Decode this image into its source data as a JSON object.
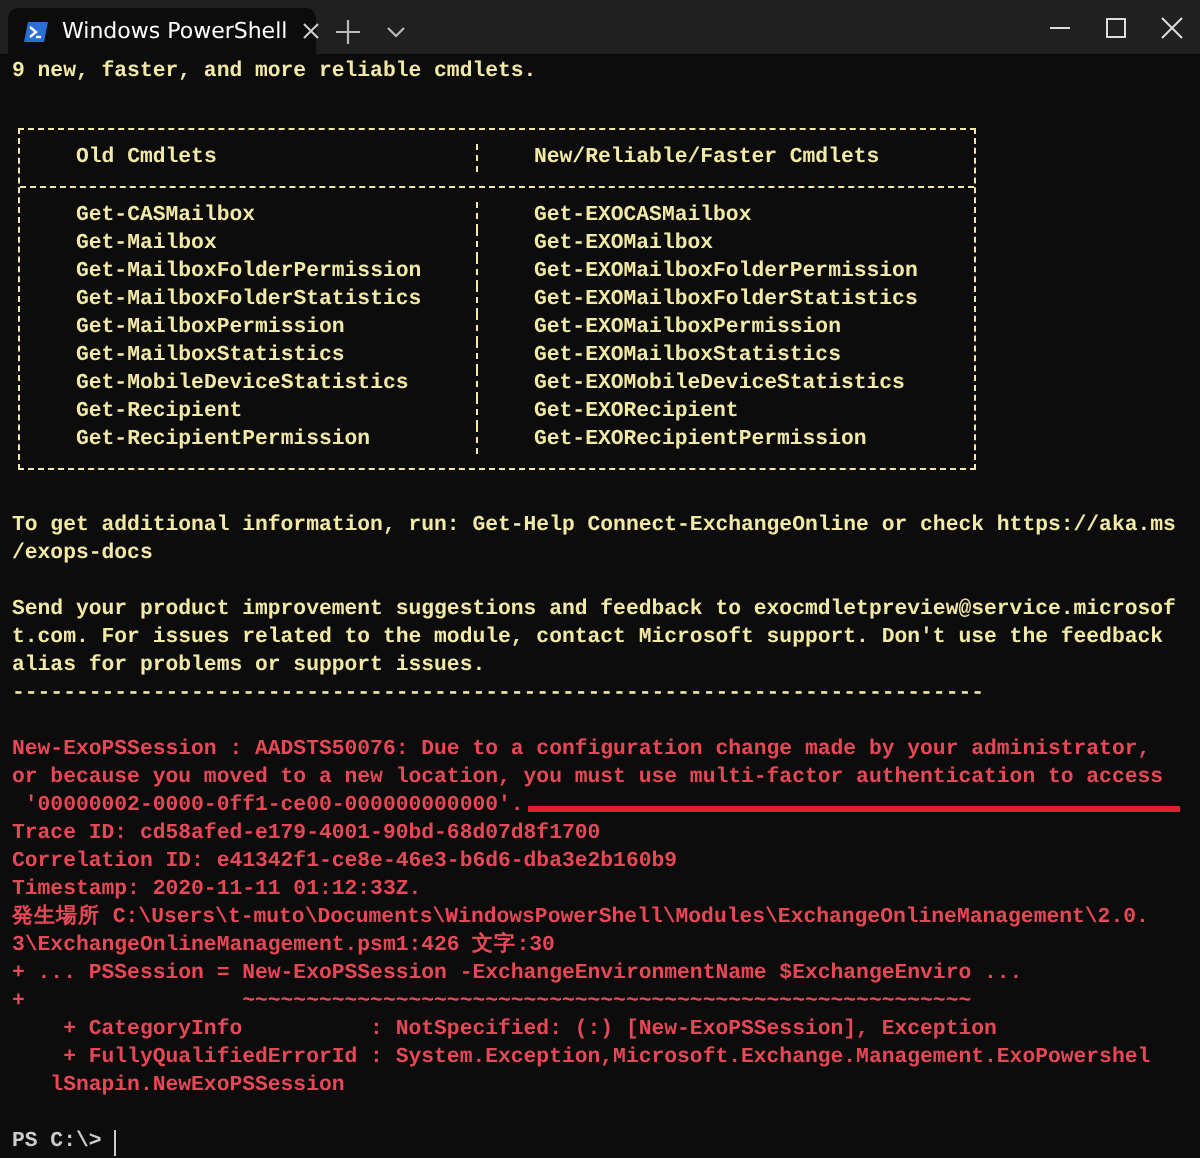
{
  "window": {
    "tab_title": "Windows PowerShell"
  },
  "terminal": {
    "lines": [
      {
        "kind": "output",
        "text": "9 new, faster, and more reliable cmdlets."
      },
      {
        "kind": "blank"
      },
      {
        "kind": "table",
        "columns": [
          "Old Cmdlets",
          "New/Reliable/Faster Cmdlets"
        ],
        "rows": [
          [
            "Get-CASMailbox",
            "Get-EXOCASMailbox"
          ],
          [
            "Get-Mailbox",
            "Get-EXOMailbox"
          ],
          [
            "Get-MailboxFolderPermission",
            "Get-EXOMailboxFolderPermission"
          ],
          [
            "Get-MailboxFolderStatistics",
            "Get-EXOMailboxFolderStatistics"
          ],
          [
            "Get-MailboxPermission",
            "Get-EXOMailboxPermission"
          ],
          [
            "Get-MailboxStatistics",
            "Get-EXOMailboxStatistics"
          ],
          [
            "Get-MobileDeviceStatistics",
            "Get-EXOMobileDeviceStatistics"
          ],
          [
            "Get-Recipient",
            "Get-EXORecipient"
          ],
          [
            "Get-RecipientPermission",
            "Get-EXORecipientPermission"
          ]
        ]
      },
      {
        "kind": "blank"
      },
      {
        "kind": "output",
        "text": "To get additional information, run: Get-Help Connect-ExchangeOnline or check https://aka.ms"
      },
      {
        "kind": "output",
        "text": "/exops-docs"
      },
      {
        "kind": "blank"
      },
      {
        "kind": "output",
        "text": "Send your product improvement suggestions and feedback to exocmdletpreview@service.microsof"
      },
      {
        "kind": "output",
        "text": "t.com. For issues related to the module, contact Microsoft support. Don't use the feedback"
      },
      {
        "kind": "output",
        "text": "alias for problems or support issues."
      },
      {
        "kind": "output",
        "text": "----------------------------------------------------------------------------"
      },
      {
        "kind": "blank"
      },
      {
        "kind": "error",
        "text": "New-ExoPSSession : AADSTS50076: Due to a configuration change made by your administrator,"
      },
      {
        "kind": "error",
        "text": "or because you moved to a new location, you must use multi-factor authentication to access"
      },
      {
        "kind": "error",
        "text": " '00000002-0000-0ff1-ce00-000000000000'.",
        "underlined": true
      },
      {
        "kind": "error",
        "text": "Trace ID: cd58afed-e179-4001-90bd-68d07d8f1700"
      },
      {
        "kind": "error",
        "text": "Correlation ID: e41342f1-ce8e-46e3-b6d6-dba3e2b160b9"
      },
      {
        "kind": "error",
        "text": "Timestamp: 2020-11-11 01:12:33Z."
      },
      {
        "kind": "error",
        "text": "発生場所 C:\\Users\\t-muto\\Documents\\WindowsPowerShell\\Modules\\ExchangeOnlineManagement\\2.0."
      },
      {
        "kind": "error",
        "text": "3\\ExchangeOnlineManagement.psm1:426 文字:30"
      },
      {
        "kind": "error",
        "text": "+ ... PSSession = New-ExoPSSession -ExchangeEnvironmentName $ExchangeEnviro ..."
      },
      {
        "kind": "error",
        "text": "+                 ~~~~~~~~~~~~~~~~~~~~~~~~~~~~~~~~~~~~~~~~~~~~~~~~~~~~~~~~~"
      },
      {
        "kind": "error",
        "text": "    + CategoryInfo          : NotSpecified: (:) [New-ExoPSSession], Exception"
      },
      {
        "kind": "error",
        "text": "    + FullyQualifiedErrorId : System.Exception,Microsoft.Exchange.Management.ExoPowershel"
      },
      {
        "kind": "error",
        "text": "   lSnapin.NewExoPSSession"
      },
      {
        "kind": "blank"
      },
      {
        "kind": "prompt",
        "text": "PS C:\\>"
      }
    ]
  }
}
